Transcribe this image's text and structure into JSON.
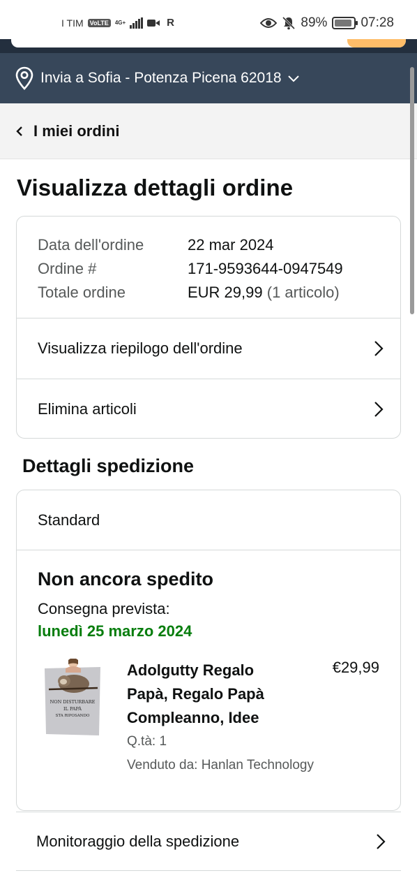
{
  "status_bar": {
    "carrier": "I TIM",
    "volte": "VoLTE",
    "network": "4G+",
    "extra": "R",
    "battery": "89%",
    "time": "07:28"
  },
  "deliver_bar": {
    "text": "Invia a Sofia - Potenza Picena 62018"
  },
  "breadcrumb": {
    "label": "I miei ordini"
  },
  "page": {
    "title": "Visualizza dettagli ordine"
  },
  "order": {
    "date_label": "Data dell'ordine",
    "date_value": "22 mar 2024",
    "number_label": "Ordine #",
    "number_value": "171-9593644-0947549",
    "total_label": "Totale ordine",
    "total_value": "EUR 29,99",
    "total_items": "(1 articolo)",
    "summary_link": "Visualizza riepilogo dell'ordine",
    "delete_link": "Elimina articoli"
  },
  "shipping": {
    "section_title": "Dettagli spedizione",
    "method": "Standard",
    "status": "Non ancora spedito",
    "estimate_label": "Consegna prevista:",
    "estimate_date": "lunedì 25 marzo 2024"
  },
  "product": {
    "title_line1": "Adolgutty Regalo",
    "title_line2": "Papà, Regalo Papà",
    "title_line3": "Compleanno, Idee",
    "price": "€29,99",
    "qty": "Q.tà: 1",
    "seller": "Venduto da: Hanlan Technology",
    "image_text_line1": "NON DISTURBARE",
    "image_text_line2": "IL PAPÀ",
    "image_text_line3": "STA RIPOSANDO"
  },
  "links": {
    "tracking": "Monitoraggio della spedizione"
  },
  "colors": {
    "deliver_bar": "#37475a",
    "header_dark": "#232f3e",
    "search_button": "#febd69",
    "delivery_green": "#067d0d"
  }
}
